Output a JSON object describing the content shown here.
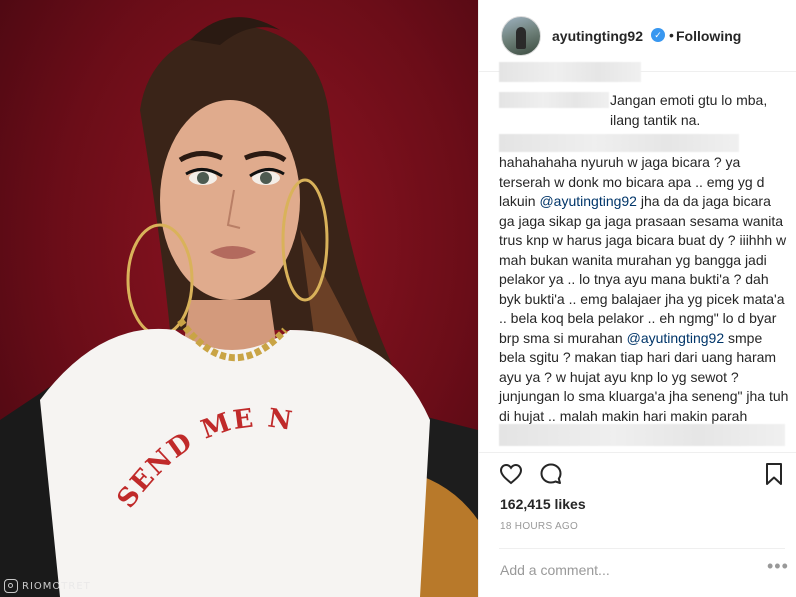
{
  "post": {
    "username": "ayutingting92",
    "verified_mark": "✓",
    "separator": "•",
    "follow_status": "Following"
  },
  "photo": {
    "shirt_text": "SEND ME NO",
    "watermark": "RIOMOTRET"
  },
  "comments": {
    "comment1_text": "Jangan emoti gtu lo mba, ilang tantik na.",
    "comment2_part1": "hahahahaha nyuruh w jaga bicara ? ya terserah w donk mo bicara apa .. emg yg d lakuin ",
    "comment2_mention1": "@ayutingting92",
    "comment2_part2": " jha da da jaga bicara ga jaga sikap ga jaga prasaan sesama wanita trus knp w harus jaga bicara buat dy ? iiihhh w mah bukan wanita murahan yg bangga jadi pelakor ya .. lo tnya ayu mana bukti'a ? dah byk bukti'a .. emg balajaer jha yg picek mata'a .. bela koq bela pelakor .. eh ngmg\" lo d byar brp sma si murahan ",
    "comment2_mention2": "@ayutingting92",
    "comment2_part3": " smpe bela sgitu ? makan tiap hari dari uang haram ayu ya ? w hujat ayu knp lo yg sewot ? junjungan lo sma kluarga'a jha seneng\" jha tuh di hujat .. malah makin hari makin parah klakuan'a .."
  },
  "actions": {
    "like_icon": "heart-icon",
    "comment_icon": "comment-bubble-icon",
    "save_icon": "bookmark-icon"
  },
  "stats": {
    "likes": "162,415 likes",
    "timestamp": "18 HOURS AGO"
  },
  "composer": {
    "placeholder": "Add a comment...",
    "more": "•••"
  },
  "colors": {
    "background_red": "#6b0d18",
    "link_blue": "#003569",
    "verified_blue": "#3897f0",
    "text": "#262626",
    "muted": "#999999"
  }
}
